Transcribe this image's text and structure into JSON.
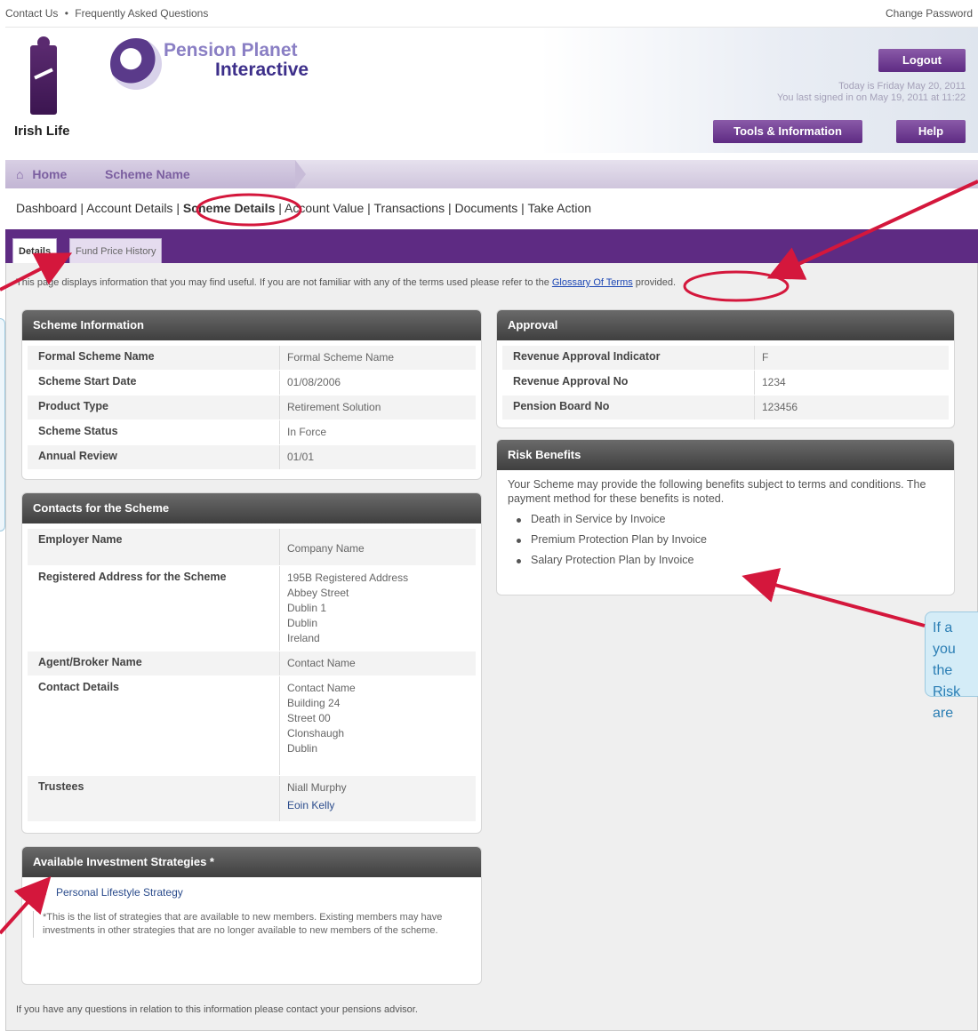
{
  "top": {
    "links": [
      "Contact Us",
      "Frequently Asked Questions"
    ],
    "separator": "•",
    "change_password": "Change Password"
  },
  "header": {
    "brand": "Irish Life",
    "product_line1": "Pension Planet",
    "product_line2": "Interactive",
    "logout": "Logout",
    "today": "Today is Friday May 20, 2011",
    "last_signed": "You last signed in on May 19, 2011 at 11:22",
    "tools": "Tools & Information",
    "help": "Help"
  },
  "breadcrumb": {
    "home": "Home",
    "scheme": "Scheme Name"
  },
  "subnav": {
    "items": [
      "Dashboard",
      "Account Details",
      "Scheme Details",
      "Account Value",
      "Transactions",
      "Documents",
      "Take Action"
    ],
    "separator": " | "
  },
  "tabs": {
    "details": "Details",
    "fund": "Fund Price History"
  },
  "intro": {
    "before": "This page displays information that you may find useful. If you are not familiar with any of the terms used please refer to the ",
    "link": "Glossary Of Terms",
    "after": " provided."
  },
  "scheme_info": {
    "title": "Scheme Information",
    "rows": [
      {
        "label": "Formal Scheme Name",
        "value": "Formal Scheme Name"
      },
      {
        "label": "Scheme Start Date",
        "value": "01/08/2006"
      },
      {
        "label": "Product Type",
        "value": "Retirement Solution"
      },
      {
        "label": "Scheme Status",
        "value": "In Force"
      },
      {
        "label": "Annual Review",
        "value": "01/01"
      }
    ]
  },
  "contacts": {
    "title": "Contacts for the Scheme",
    "employer_label": "Employer Name",
    "employer_value": "Company Name",
    "address_label": "Registered Address for the Scheme",
    "address_lines": [
      "195B Registered Address",
      "Abbey Street",
      "Dublin 1",
      "Dublin",
      "Ireland"
    ],
    "agent_label": "Agent/Broker Name",
    "agent_value": "Contact Name",
    "contact_label": "Contact Details",
    "contact_lines": [
      "Contact Name",
      "Building 24",
      "Street 00",
      "Clonshaugh",
      "Dublin"
    ],
    "trustees_label": "Trustees",
    "trustees": [
      "Niall Murphy",
      "Eoin Kelly"
    ]
  },
  "strategies": {
    "title": "Available Investment Strategies *",
    "items": [
      "Personal Lifestyle Strategy"
    ],
    "note": "*This is the list of strategies that are available to new members. Existing members may have investments in other strategies that are no longer available to new members of the scheme."
  },
  "approval": {
    "title": "Approval",
    "rows": [
      {
        "label": "Revenue Approval Indicator",
        "value": "F"
      },
      {
        "label": "Revenue Approval No",
        "value": "1234"
      },
      {
        "label": "Pension Board No",
        "value": "123456"
      }
    ]
  },
  "risk": {
    "title": "Risk Benefits",
    "text": "Your Scheme may provide the following benefits subject to terms and conditions. The payment method for these benefits is noted.",
    "items": [
      "Death in Service by Invoice",
      "Premium Protection Plan by Invoice",
      "Salary Protection Plan by Invoice"
    ]
  },
  "footer": "If you have any questions in relation to this information please contact your pensions advisor.",
  "callout_lines": [
    "If a",
    "you",
    "the",
    "Risk",
    "are"
  ],
  "colors": {
    "brand_purple": "#5e2b83",
    "annotation_red": "#d4173c",
    "callout_blue": "#2b7eb4"
  }
}
